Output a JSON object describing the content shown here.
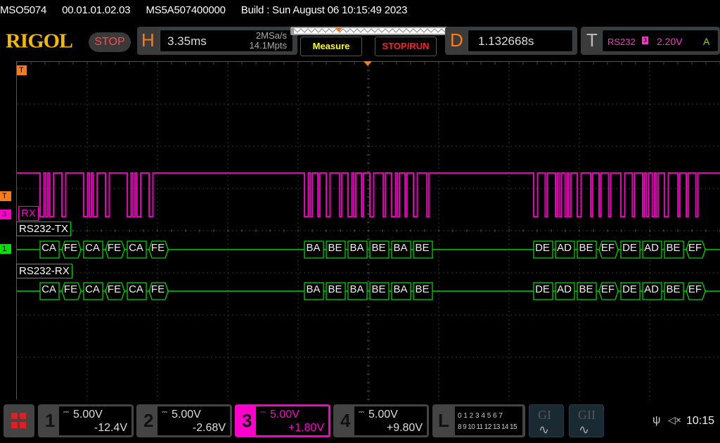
{
  "status_bar": {
    "model": "MSO5074",
    "version": "00.01.01.02.03",
    "serial": "MS5A507400000",
    "build": "Build : Sun August 06 10:15:49 2023"
  },
  "logo": "RIGOL",
  "run_state": "STOP",
  "horizontal": {
    "letter": "H",
    "timebase": "3.35ms",
    "sample_rate": "2MSa/s",
    "memory_depth": "14.1Mpts"
  },
  "buttons": {
    "measure": "Measure",
    "stop_run": "STOP/RUN"
  },
  "delay": {
    "letter": "D",
    "value": "1.132668s"
  },
  "trigger": {
    "letter": "T",
    "type": "RS232",
    "source": "3",
    "level": "2.20V",
    "mode": "A"
  },
  "markers": {
    "trigger_pos": "T",
    "trigger_level": "T",
    "ch3": "3",
    "ch1": "1"
  },
  "ch3_label": "RX",
  "decoders": [
    {
      "label": "RS232-TX",
      "packets": [
        {
          "v": "CA",
          "shape": "rect"
        },
        {
          "v": "FE",
          "shape": "hex"
        },
        {
          "v": "CA",
          "shape": "rect"
        },
        {
          "v": "FE",
          "shape": "hex"
        },
        {
          "v": "CA",
          "shape": "rect"
        },
        {
          "v": "FE",
          "shape": "hex"
        },
        {
          "v": "BA",
          "shape": "rect"
        },
        {
          "v": "BE",
          "shape": "rect"
        },
        {
          "v": "BA",
          "shape": "rect"
        },
        {
          "v": "BE",
          "shape": "rect"
        },
        {
          "v": "BA",
          "shape": "rect"
        },
        {
          "v": "BE",
          "shape": "rect"
        },
        {
          "v": "DE",
          "shape": "rect"
        },
        {
          "v": "AD",
          "shape": "rect"
        },
        {
          "v": "BE",
          "shape": "rect"
        },
        {
          "v": "EF",
          "shape": "hex"
        },
        {
          "v": "DE",
          "shape": "rect"
        },
        {
          "v": "AD",
          "shape": "rect"
        },
        {
          "v": "BE",
          "shape": "rect"
        },
        {
          "v": "EF",
          "shape": "hex"
        }
      ]
    },
    {
      "label": "RS232-RX",
      "packets": [
        {
          "v": "CA",
          "shape": "rect"
        },
        {
          "v": "FE",
          "shape": "hex"
        },
        {
          "v": "CA",
          "shape": "rect"
        },
        {
          "v": "FE",
          "shape": "hex"
        },
        {
          "v": "CA",
          "shape": "rect"
        },
        {
          "v": "FE",
          "shape": "hex"
        },
        {
          "v": "BA",
          "shape": "rect"
        },
        {
          "v": "BE",
          "shape": "rect"
        },
        {
          "v": "BA",
          "shape": "rect"
        },
        {
          "v": "BE",
          "shape": "rect"
        },
        {
          "v": "BA",
          "shape": "rect"
        },
        {
          "v": "BE",
          "shape": "rect"
        },
        {
          "v": "DE",
          "shape": "rect"
        },
        {
          "v": "AD",
          "shape": "rect"
        },
        {
          "v": "BE",
          "shape": "rect"
        },
        {
          "v": "EF",
          "shape": "hex"
        },
        {
          "v": "DE",
          "shape": "rect"
        },
        {
          "v": "AD",
          "shape": "rect"
        },
        {
          "v": "BE",
          "shape": "rect"
        },
        {
          "v": "EF",
          "shape": "hex"
        }
      ]
    }
  ],
  "channels": [
    {
      "num": "1",
      "scale": "5.00V",
      "offset": "-12.4V",
      "active": false
    },
    {
      "num": "2",
      "scale": "5.00V",
      "offset": "-2.68V",
      "active": false
    },
    {
      "num": "3",
      "scale": "5.00V",
      "offset": "+1.80V",
      "active": true
    },
    {
      "num": "4",
      "scale": "5.00V",
      "offset": "+9.80V",
      "active": false
    }
  ],
  "logic": {
    "letter": "L",
    "row1": "0 1 2 3  4 5 6 7",
    "row2": "8 9 10 11 12 13 14 15"
  },
  "generators": [
    {
      "label": "GI"
    },
    {
      "label": "GII"
    }
  ],
  "clock": "10:15",
  "colors": {
    "ch1": "#00e000",
    "ch3": "#ff00cc",
    "decode": "#00d000",
    "trigger": "#ff7a1a",
    "logo": "#f5b800",
    "measure": "#ffff00",
    "stop_run": "#ff2020"
  }
}
